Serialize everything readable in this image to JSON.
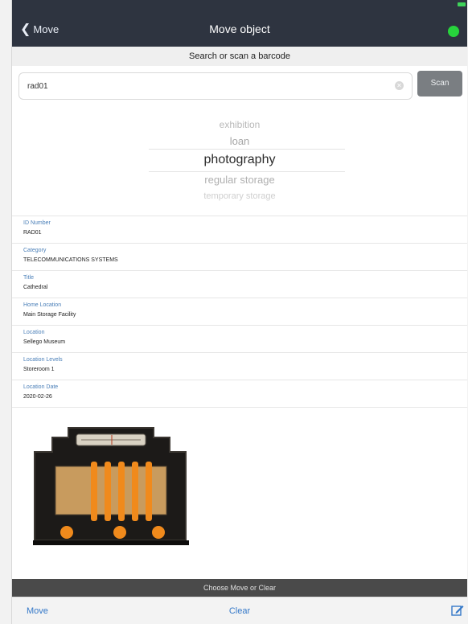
{
  "navbar": {
    "back_label": "Move",
    "title": "Move object",
    "status_color": "#27d33c"
  },
  "search": {
    "header": "Search or scan a barcode",
    "value": "rad01",
    "scan_label": "Scan"
  },
  "picker": {
    "options": [
      "exhibition",
      "loan",
      "photography",
      "regular storage",
      "temporary storage"
    ],
    "selected": "photography"
  },
  "fields": [
    {
      "label": "ID Number",
      "value": "RAD01"
    },
    {
      "label": "Category",
      "value": "TELECOMMUNICATIONS SYSTEMS"
    },
    {
      "label": "Title",
      "value": "Cathedral"
    },
    {
      "label": "Home Location",
      "value": "Main Storage Facility"
    },
    {
      "label": "Location",
      "value": "Sellego Museum"
    },
    {
      "label": "Location Levels",
      "value": "Storeroom 1"
    },
    {
      "label": "Location Date",
      "value": "2020-02-26"
    }
  ],
  "banner": "Choose Move or Clear",
  "toolbar": {
    "move_label": "Move",
    "clear_label": "Clear",
    "edit_icon": "compose-icon"
  },
  "colors": {
    "navbar": "#2e3440",
    "accent": "#3478c8",
    "field_label": "#4a7fb8",
    "scan_button": "#7a7e82"
  }
}
